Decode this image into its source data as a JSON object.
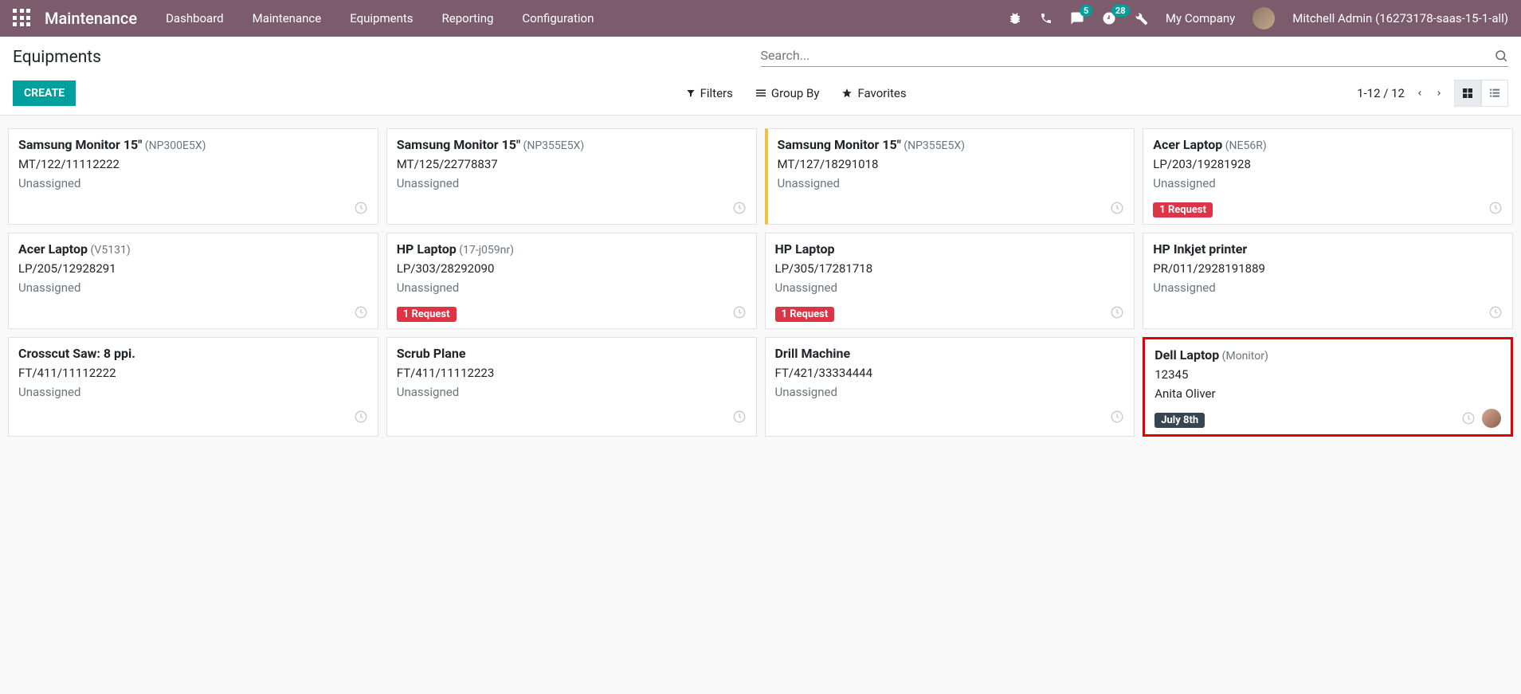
{
  "nav": {
    "brand": "Maintenance",
    "items": [
      "Dashboard",
      "Maintenance",
      "Equipments",
      "Reporting",
      "Configuration"
    ],
    "msg_badge": "5",
    "activity_badge": "28",
    "company": "My Company",
    "user": "Mitchell Admin (16273178-saas-15-1-all)"
  },
  "page": {
    "title": "Equipments",
    "search_placeholder": "Search...",
    "create": "CREATE",
    "filters": "Filters",
    "groupby": "Group By",
    "favorites": "Favorites",
    "pager": "1-12 / 12"
  },
  "cards": [
    {
      "name": "Samsung Monitor 15\"",
      "model": "(NP300E5X)",
      "serial": "MT/122/11112222",
      "assignee": "Unassigned",
      "req": null,
      "date": null,
      "yellow": false,
      "red": false,
      "avatar": false
    },
    {
      "name": "Samsung Monitor 15\"",
      "model": "(NP355E5X)",
      "serial": "MT/125/22778837",
      "assignee": "Unassigned",
      "req": null,
      "date": null,
      "yellow": false,
      "red": false,
      "avatar": false
    },
    {
      "name": "Samsung Monitor 15\"",
      "model": "(NP355E5X)",
      "serial": "MT/127/18291018",
      "assignee": "Unassigned",
      "req": null,
      "date": null,
      "yellow": true,
      "red": false,
      "avatar": false
    },
    {
      "name": "Acer Laptop",
      "model": "(NE56R)",
      "serial": "LP/203/19281928",
      "assignee": "Unassigned",
      "req": "1 Request",
      "date": null,
      "yellow": false,
      "red": false,
      "avatar": false
    },
    {
      "name": "Acer Laptop",
      "model": "(V5131)",
      "serial": "LP/205/12928291",
      "assignee": "Unassigned",
      "req": null,
      "date": null,
      "yellow": false,
      "red": false,
      "avatar": false
    },
    {
      "name": "HP Laptop",
      "model": "(17-j059nr)",
      "serial": "LP/303/28292090",
      "assignee": "Unassigned",
      "req": "1 Request",
      "date": null,
      "yellow": false,
      "red": false,
      "avatar": false
    },
    {
      "name": "HP Laptop",
      "model": "",
      "serial": "LP/305/17281718",
      "assignee": "Unassigned",
      "req": "1 Request",
      "date": null,
      "yellow": false,
      "red": false,
      "avatar": false
    },
    {
      "name": "HP Inkjet printer",
      "model": "",
      "serial": "PR/011/2928191889",
      "assignee": "Unassigned",
      "req": null,
      "date": null,
      "yellow": false,
      "red": false,
      "avatar": false
    },
    {
      "name": "Crosscut Saw: 8 ppi.",
      "model": "",
      "serial": "FT/411/11112222",
      "assignee": "Unassigned",
      "req": null,
      "date": null,
      "yellow": false,
      "red": false,
      "avatar": false
    },
    {
      "name": "Scrub Plane",
      "model": "",
      "serial": "FT/411/11112223",
      "assignee": "Unassigned",
      "req": null,
      "date": null,
      "yellow": false,
      "red": false,
      "avatar": false
    },
    {
      "name": "Drill Machine",
      "model": "",
      "serial": "FT/421/33334444",
      "assignee": "Unassigned",
      "req": null,
      "date": null,
      "yellow": false,
      "red": false,
      "avatar": false
    },
    {
      "name": "Dell Laptop",
      "model": "(Monitor)",
      "serial": "12345",
      "assignee": "Anita Oliver",
      "req": null,
      "date": "July 8th",
      "yellow": false,
      "red": true,
      "avatar": true
    }
  ]
}
